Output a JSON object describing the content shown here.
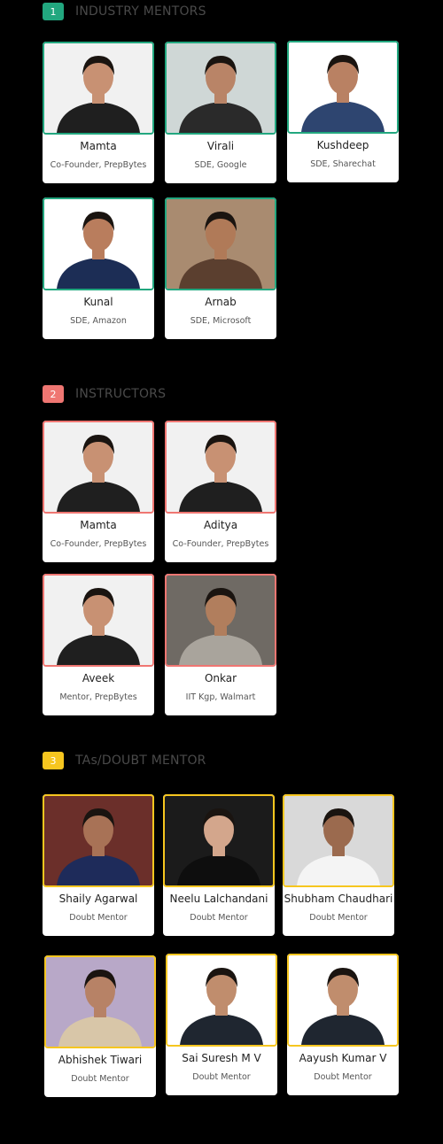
{
  "colors": {
    "mentor": "#22a77f",
    "instructor": "#ef7672",
    "ta": "#f6c61f"
  },
  "sections": [
    {
      "number": "1",
      "title": "INDUSTRY MENTORS",
      "people": [
        {
          "name": "Mamta",
          "role": "Co-Founder, PrepBytes",
          "shirt": "dark-tee"
        },
        {
          "name": "Virali",
          "role": "SDE, Google",
          "shirt": "outdoor"
        },
        {
          "name": "Kushdeep",
          "role": "SDE, Sharechat",
          "shirt": "blue-shirt"
        },
        {
          "name": "Kunal",
          "role": "SDE, Amazon",
          "shirt": "navy-tee"
        },
        {
          "name": "Arnab",
          "role": "SDE, Microsoft",
          "shirt": "closeup"
        }
      ]
    },
    {
      "number": "2",
      "title": "INSTRUCTORS",
      "people": [
        {
          "name": "Mamta",
          "role": "Co-Founder, PrepBytes",
          "shirt": "dark-tee"
        },
        {
          "name": "Aditya",
          "role": "Co-Founder, PrepBytes",
          "shirt": "dark-tee"
        },
        {
          "name": "Aveek",
          "role": "Mentor, PrepBytes",
          "shirt": "dark-tee"
        },
        {
          "name": "Onkar",
          "role": "IIT Kgp, Walmart",
          "shirt": "grey-shirt"
        }
      ]
    },
    {
      "number": "3",
      "title": "TAs/DOUBT MENTOR",
      "people": [
        {
          "name": "Shaily Agarwal",
          "role": "Doubt Mentor",
          "shirt": "navy-top"
        },
        {
          "name": "Neelu Lalchandani",
          "role": "Doubt Mentor",
          "shirt": "black-blazer"
        },
        {
          "name": "Shubham Chaudhari",
          "role": "Doubt Mentor",
          "shirt": "white-shirt"
        },
        {
          "name": "Abhishek Tiwari",
          "role": "Doubt Mentor",
          "shirt": "print-shirt"
        },
        {
          "name": "Sai Suresh M V",
          "role": "Doubt Mentor",
          "shirt": "suit"
        },
        {
          "name": "Aayush Kumar V",
          "role": "Doubt Mentor",
          "shirt": "suit"
        }
      ]
    }
  ]
}
